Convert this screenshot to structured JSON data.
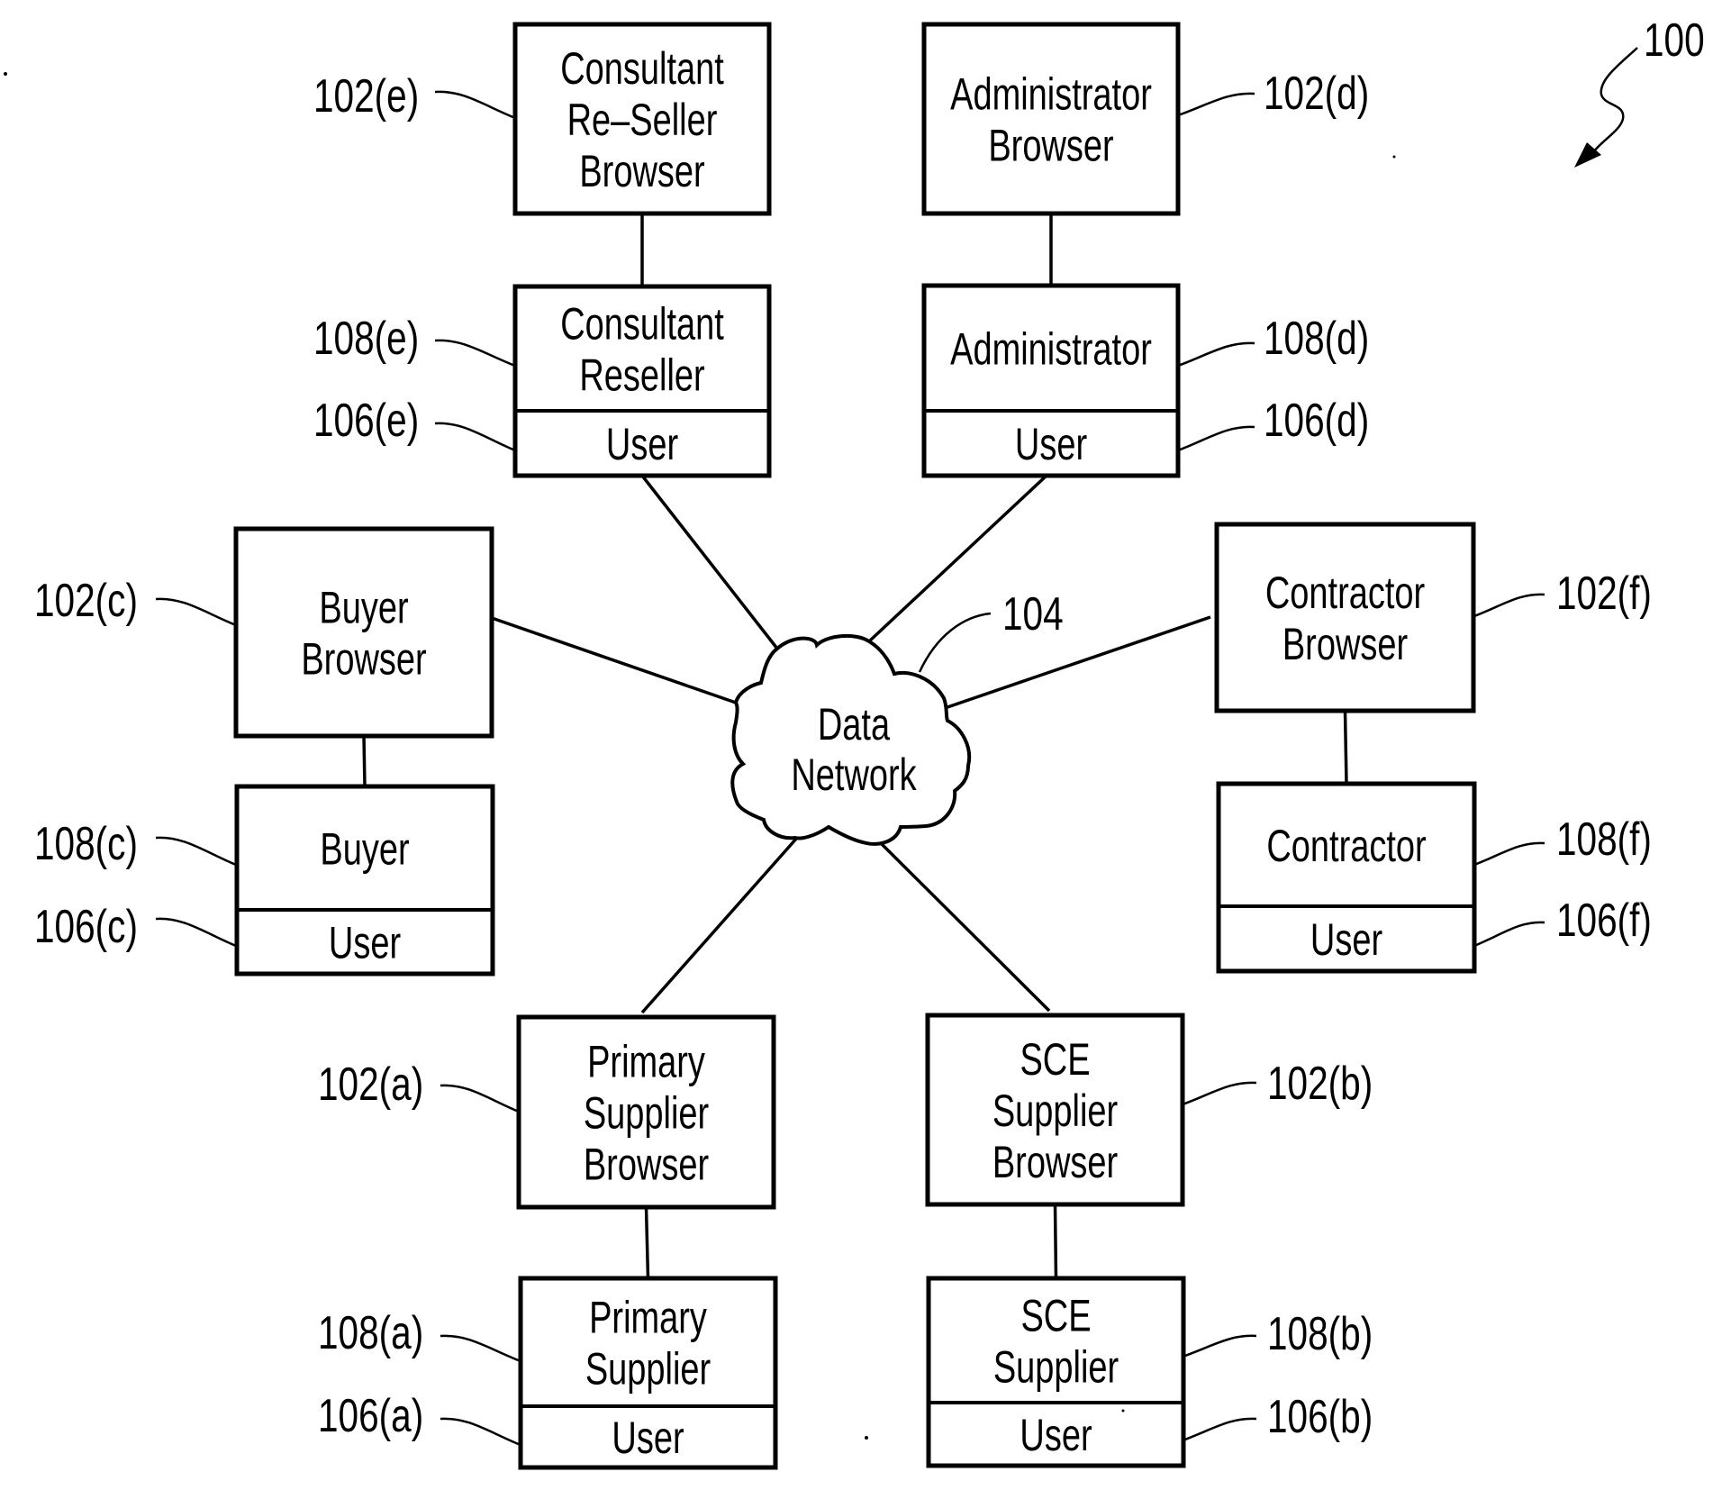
{
  "figure": {
    "reference": "100",
    "network": {
      "ref": "104",
      "label_lines": [
        "Data",
        "Network"
      ]
    },
    "nodes": [
      {
        "id": "e",
        "browser": {
          "ref": "102(e)",
          "lines": [
            "Consultant",
            "Re–Seller",
            "Browser"
          ]
        },
        "role": {
          "ref": "108(e)",
          "lines": [
            "Consultant",
            "Reseller"
          ]
        },
        "user": {
          "ref": "106(e)",
          "label": "User"
        }
      },
      {
        "id": "d",
        "browser": {
          "ref": "102(d)",
          "lines": [
            "Administrator",
            "Browser"
          ]
        },
        "role": {
          "ref": "108(d)",
          "lines": [
            "Administrator"
          ]
        },
        "user": {
          "ref": "106(d)",
          "label": "User"
        }
      },
      {
        "id": "c",
        "browser": {
          "ref": "102(c)",
          "lines": [
            "Buyer",
            "Browser"
          ]
        },
        "role": {
          "ref": "108(c)",
          "lines": [
            "Buyer"
          ]
        },
        "user": {
          "ref": "106(c)",
          "label": "User"
        }
      },
      {
        "id": "f",
        "browser": {
          "ref": "102(f)",
          "lines": [
            "Contractor",
            "Browser"
          ]
        },
        "role": {
          "ref": "108(f)",
          "lines": [
            "Contractor"
          ]
        },
        "user": {
          "ref": "106(f)",
          "label": "User"
        }
      },
      {
        "id": "a",
        "browser": {
          "ref": "102(a)",
          "lines": [
            "Primary",
            "Supplier",
            "Browser"
          ]
        },
        "role": {
          "ref": "108(a)",
          "lines": [
            "Primary",
            "Supplier"
          ]
        },
        "user": {
          "ref": "106(a)",
          "label": "User"
        }
      },
      {
        "id": "b",
        "browser": {
          "ref": "102(b)",
          "lines": [
            "SCE",
            "Supplier",
            "Browser"
          ]
        },
        "role": {
          "ref": "108(b)",
          "lines": [
            "SCE",
            "Supplier"
          ]
        },
        "user": {
          "ref": "106(b)",
          "label": "User"
        }
      }
    ]
  }
}
